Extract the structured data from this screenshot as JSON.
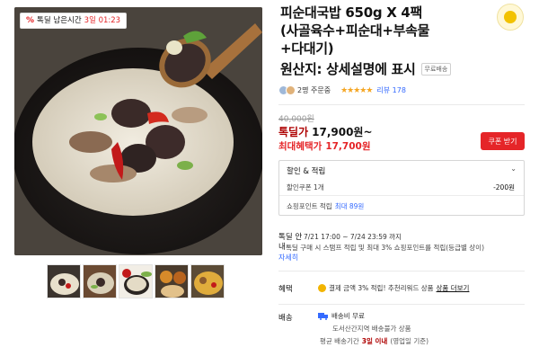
{
  "gallery": {
    "timer_badge": {
      "icon": "percent-badge-icon",
      "pct": "%",
      "label": "톡딜 남은시간",
      "time": "3일 01:23"
    },
    "thumbnails": [
      "soup-thumb-1",
      "soup-thumb-2",
      "soup-thumb-3",
      "soup-thumb-4",
      "soup-thumb-5"
    ]
  },
  "product": {
    "title_lines": [
      "피순대국밥 650g X 4팩",
      "(사골육수+피순대+부속물",
      "+다대기)"
    ],
    "origin": "원산지: 상세설명에 표시",
    "ship_tag": "무료배송",
    "review": {
      "buyers": "2명 주문중",
      "stars": "★★★★★",
      "link": "리뷰 178"
    }
  },
  "price": {
    "original": "40,000원",
    "deal_label": "톡딜가",
    "deal_price": "17,900원~",
    "max_label": "최대혜택가",
    "max_price": "17,700원",
    "coupon_button": "쿠폰 받기"
  },
  "benefit_box": {
    "title": "할인 & 적립",
    "coupon_label": "할인쿠폰 1개",
    "coupon_value": "-200원",
    "points_prefix": "쇼핑포인트 적립",
    "points_highlight": "최대 89원"
  },
  "deal_info": {
    "label_line1": "톡딜 안",
    "label_line2": "내",
    "period": "7/21 17:00 ~ 7/24 23:59 까지",
    "desc": "톡딜 구매 시 스탬프 적립 및 최대 3% 쇼핑포인트를 적립(등급별 상이)",
    "detail_link": "자세히"
  },
  "benefit": {
    "label": "혜택",
    "text": "결제 금액 3% 적립! 추천리워드 상품",
    "link": "상품 더보기"
  },
  "shipping": {
    "label": "배송",
    "fee": "배송비 무료",
    "remote": "도서산간지역 배송불가 상품",
    "avg_prefix": "평균 배송기간",
    "avg_bold": "3일 이내",
    "avg_suffix": "(영업일 기준)"
  },
  "colors": {
    "accent_red": "#e52528",
    "deal_dark_red": "#ae0000",
    "link_blue": "#346aff",
    "star": "#f5a623"
  }
}
